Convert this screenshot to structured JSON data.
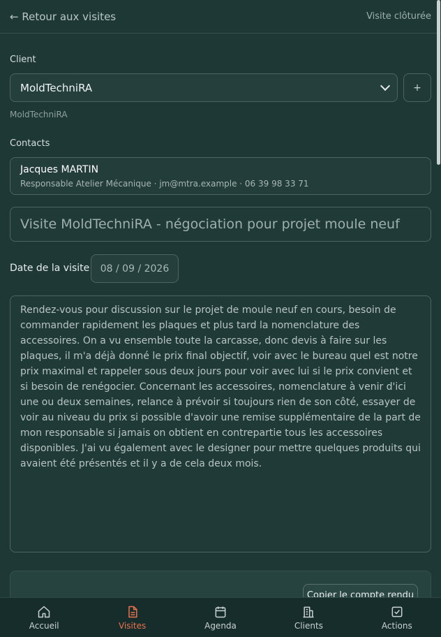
{
  "header": {
    "back_label": "← Retour aux visites",
    "status": "Visite clôturée"
  },
  "client": {
    "label": "Client",
    "selected": "MoldTechniRA",
    "add_label": "+",
    "subtitle": "MoldTechniRA"
  },
  "contacts": {
    "label": "Contacts",
    "items": [
      {
        "name": "Jacques MARTIN",
        "details": "Responsable Atelier Mécanique · jm@mtra.example · 06 39 98 33 71"
      }
    ]
  },
  "visit": {
    "title": "Visite MoldTechniRA - négociation pour projet moule neuf",
    "date_label": "Date de la visite",
    "date": "08 / 09 / 2026",
    "notes": "Rendez-vous pour discussion sur le projet de moule neuf en cours, besoin de commander rapidement les plaques et plus tard la nomenclature des accessoires. On a vu ensemble toute la carcasse, donc devis à faire sur les plaques, il m'a déjà donné le prix final objectif, voir avec le bureau quel est notre prix maximal et rappeler sous deux jours pour voir avec lui si le prix convient et si besoin de renégocier. Concernant les accessoires, nomenclature à venir d'ici une ou deux semaines, relance à prévoir si toujours rien de son côté, essayer de voir au niveau du prix si possible d'avoir une remise supplémentaire de la part de mon responsable si jamais on obtient en contrepartie tous les accessoires disponibles. J'ai vu également avec le designer pour mettre quelques produits qui avaient été présentés et il y a de cela deux mois."
  },
  "report": {
    "copy_label": "Copier le compte rendu"
  },
  "nav": {
    "items": [
      {
        "label": "Accueil",
        "icon": "home-icon"
      },
      {
        "label": "Visites",
        "icon": "document-icon",
        "active": true
      },
      {
        "label": "Agenda",
        "icon": "calendar-icon"
      },
      {
        "label": "Clients",
        "icon": "building-icon"
      },
      {
        "label": "Actions",
        "icon": "checkbox-icon"
      }
    ],
    "accent": "#e8724f"
  }
}
